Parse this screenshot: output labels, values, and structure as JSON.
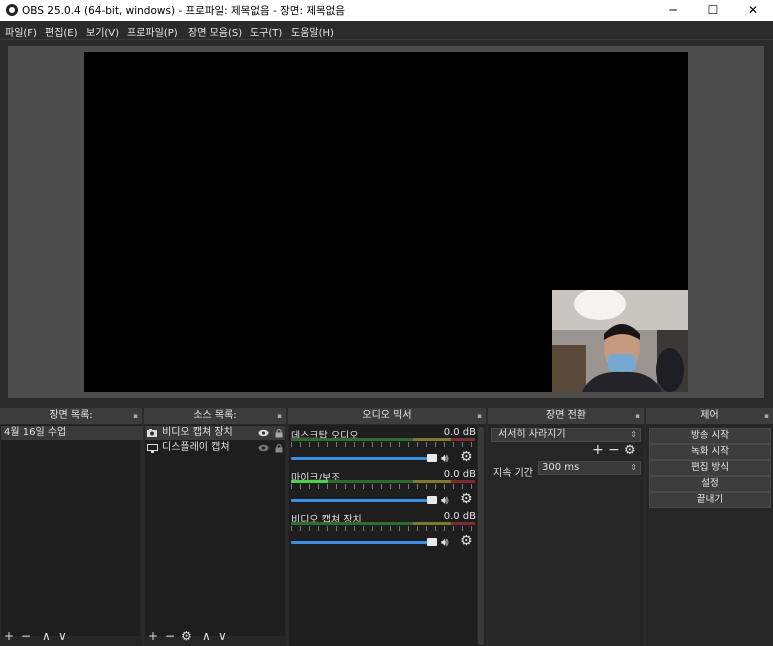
{
  "window": {
    "title": "OBS 25.0.4 (64-bit, windows) - 프로파일: 제목없음 - 장면: 제목없음",
    "minimize": "─",
    "maximize": "☐",
    "close": "✕"
  },
  "menu": [
    "파일(F)",
    "편집(E)",
    "보기(V)",
    "프로파일(P)",
    "장면 모음(S)",
    "도구(T)",
    "도움말(H)"
  ],
  "scenes": {
    "title": "장면 목록:",
    "items": [
      "4월 16일 수업"
    ]
  },
  "sources": {
    "title": "소스 목록:",
    "items": [
      {
        "label": "비디오 캡쳐 장치",
        "icon": "camera-icon"
      },
      {
        "label": "디스플레이 캡쳐",
        "icon": "monitor-icon"
      }
    ]
  },
  "mixer": {
    "title": "오디오 믹서",
    "tracks": [
      {
        "name": "데스크탑 오디오",
        "db": "0.0 dB",
        "level": 0
      },
      {
        "name": "마이크/보조",
        "db": "0.0 dB",
        "level": 0.2
      },
      {
        "name": "비디오 캡쳐 장치",
        "db": "0.0 dB",
        "level": 0
      }
    ]
  },
  "transitions": {
    "title": "장면 전환",
    "selected": "서서히 사라지기",
    "duration_label": "지속 기간",
    "duration_value": "300 ms"
  },
  "controls": {
    "title": "제어",
    "buttons": [
      "방송 시작",
      "녹화 시작",
      "편집 방식",
      "설정",
      "끝내기"
    ]
  },
  "toolbar_glyphs": {
    "add": "+",
    "remove": "−",
    "gear": "⚙",
    "up": "∧",
    "down": "∨"
  },
  "float_glyph": "▪"
}
